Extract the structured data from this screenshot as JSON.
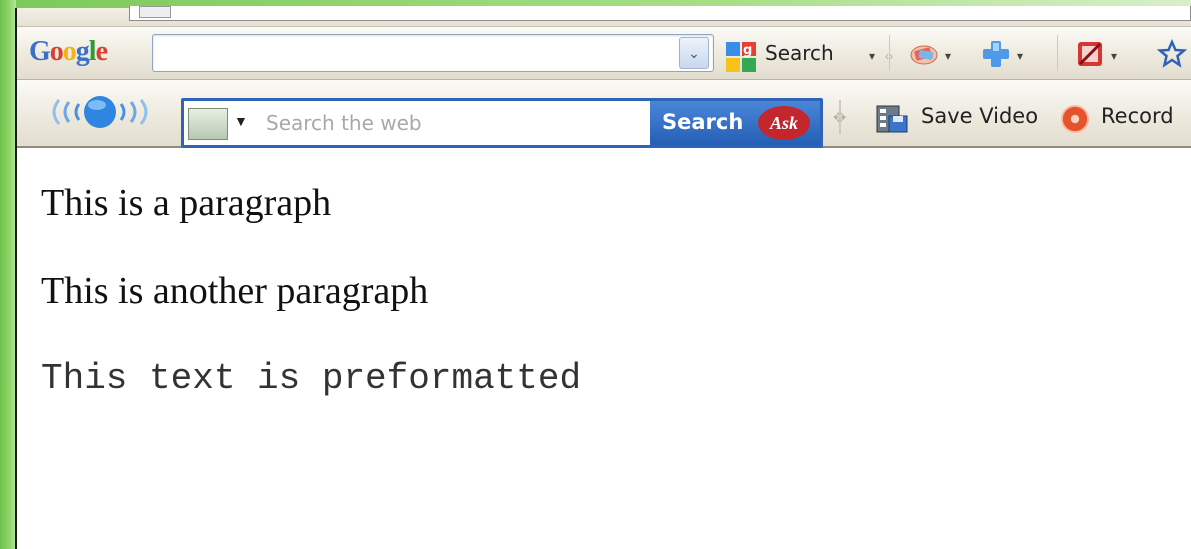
{
  "google_toolbar": {
    "logo": "Google",
    "search_value": "",
    "search_label": "Search"
  },
  "ask_toolbar": {
    "search_placeholder": "Search the web",
    "search_button": "Search",
    "ask_badge": "Ask",
    "save_video_label": "Save Video",
    "record_label": "Record"
  },
  "page": {
    "paragraph_1": "This is a paragraph",
    "paragraph_2": "This is another paragraph",
    "preformatted": "This text is preformatted"
  },
  "icons": {
    "google_dropdown": "chevron-down-icon",
    "google_search": "google-services-icon",
    "bookmark": "star-icon",
    "ask_logo": "sound-waves-icon",
    "save_video": "save-video-icon",
    "record": "record-icon"
  },
  "colors": {
    "ask_button": "#2f63b8",
    "ask_badge": "#c4262e",
    "desktop_green": "#8fd66a"
  }
}
